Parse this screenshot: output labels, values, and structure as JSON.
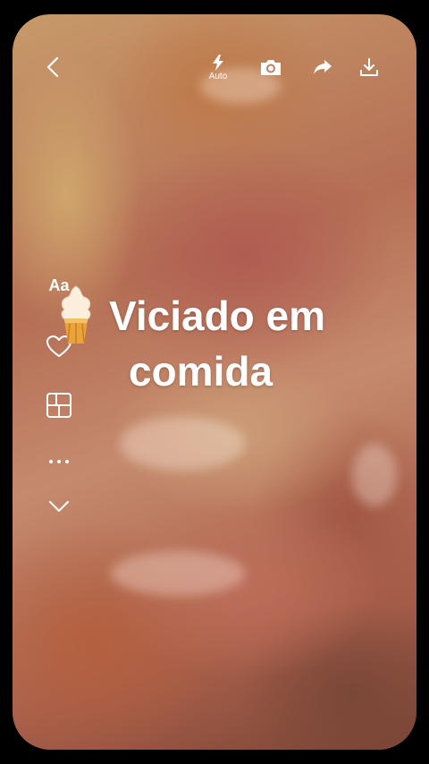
{
  "toolbar": {
    "back_icon": "chevron-left-icon",
    "flash_icon": "flash-icon",
    "flash_label": "Auto",
    "camera_icon": "camera-icon",
    "share_icon": "share-arrow-icon",
    "download_icon": "download-icon"
  },
  "sidebar": {
    "text_tool_label": "Aa",
    "items": [
      "heart-icon",
      "layout-icon",
      "more-icon",
      "chevron-down-icon"
    ]
  },
  "sticker": {
    "name": "ice-cream-icon"
  },
  "caption": {
    "line1": "Viciado em",
    "line2": "comida"
  },
  "colors": {
    "text": "#ffffff",
    "background": "#000000"
  }
}
